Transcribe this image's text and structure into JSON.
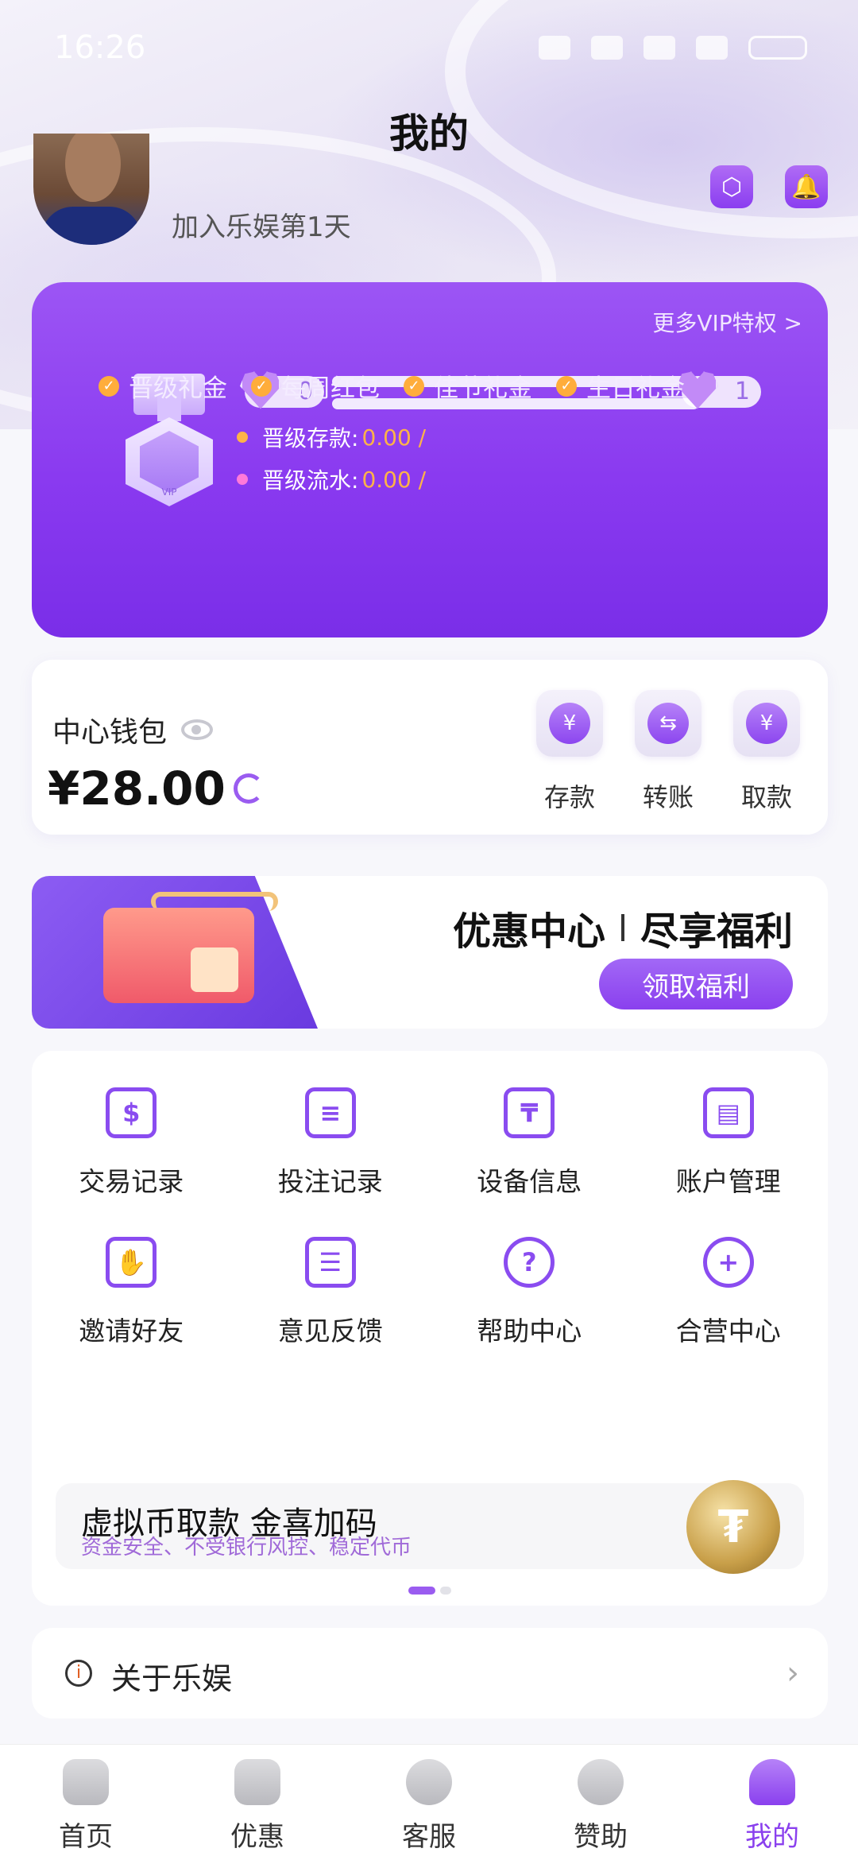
{
  "status_bar": {
    "time": "16:26"
  },
  "header": {
    "title": "我的",
    "join_text": "加入乐娱第1天"
  },
  "vip": {
    "more_link": "更多VIP特权 >",
    "current_level": "0",
    "next_level": "1",
    "deposit_label": "晋级存款:",
    "deposit_value": "0.00 /",
    "turnover_label": "晋级流水:",
    "turnover_value": "0.00 /",
    "perks": [
      "晋级礼金",
      "每周红包",
      "佳节礼金",
      "生日礼金"
    ],
    "colors": {
      "card": "#8a3af0",
      "value": "#ffb347"
    }
  },
  "wallet": {
    "title": "中心钱包",
    "balance": "¥28.00",
    "actions": [
      "存款",
      "转账",
      "取款"
    ]
  },
  "promo": {
    "title_left": "优惠中心",
    "title_right": "尽享福利",
    "button": "领取福利"
  },
  "menu": {
    "items": [
      {
        "label": "交易记录",
        "icon": "receipt-icon"
      },
      {
        "label": "投注记录",
        "icon": "bet-record-icon"
      },
      {
        "label": "设备信息",
        "icon": "laptop-icon"
      },
      {
        "label": "账户管理",
        "icon": "id-card-icon"
      },
      {
        "label": "邀请好友",
        "icon": "invite-icon"
      },
      {
        "label": "意见反馈",
        "icon": "feedback-icon"
      },
      {
        "label": "帮助中心",
        "icon": "help-icon"
      },
      {
        "label": "合营中心",
        "icon": "add-user-icon"
      }
    ],
    "crypto_title": "虚拟币取款  金喜加码",
    "crypto_subtitle": "资金安全、不受银行风控、稳定代币"
  },
  "about": {
    "label": "关于乐娱"
  },
  "tabbar": {
    "tabs": [
      "首页",
      "优惠",
      "客服",
      "赞助",
      "我的"
    ],
    "active_index": 4
  }
}
